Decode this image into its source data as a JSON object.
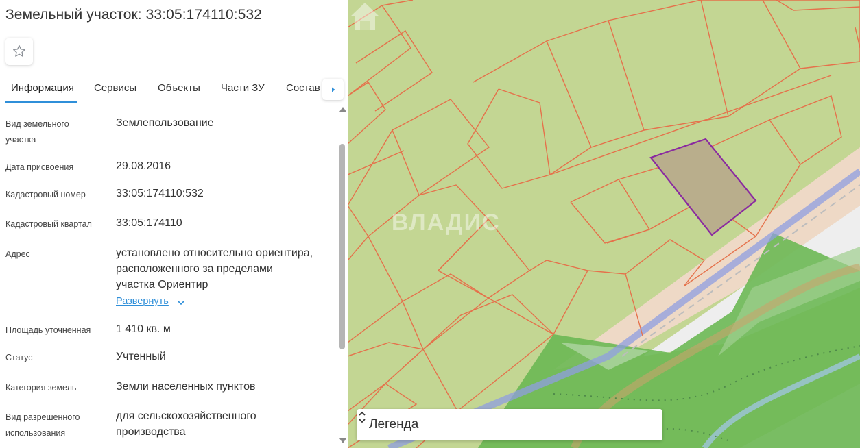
{
  "header": {
    "title": "Земельный участок: 33:05:174110:532",
    "favorite_icon": "star-outline-icon"
  },
  "tabs": [
    {
      "label": "Информация",
      "active": true
    },
    {
      "label": "Сервисы"
    },
    {
      "label": "Объекты"
    },
    {
      "label": "Части ЗУ"
    },
    {
      "label": "Состав"
    }
  ],
  "tabs_next_icon": "caret-right-icon",
  "info": {
    "rows": [
      {
        "label": "Вид земельного участка",
        "value": "Землепользование"
      },
      {
        "label": "Дата присвоения",
        "value": "29.08.2016"
      },
      {
        "label": "Кадастровый номер",
        "value": "33:05:174110:532"
      },
      {
        "label": "Кадастровый квартал",
        "value": "33:05:174110"
      },
      {
        "label": "Адрес",
        "value": "установлено относительно ориентира, расположенного за пределами участка Ориентир",
        "expand": "Развернуть"
      },
      {
        "label": "Площадь уточненная",
        "value": "1 410 кв. м"
      },
      {
        "label": "Статус",
        "value": "Учтенный"
      },
      {
        "label": "Категория земель",
        "value": "Земли населенных пунктов"
      },
      {
        "label": "Вид разрешенного использования",
        "value": "для сельскохозяйственного производства"
      }
    ]
  },
  "map": {
    "watermark": "ВЛАДИС",
    "legend_label": "Легенда",
    "colors": {
      "parcel_fill": "#c3d693",
      "parcel_border": "#e5714b",
      "selected_border": "#8a2aa0",
      "selected_fill": "#b9ae8c",
      "forest": "#6cb854"
    }
  }
}
